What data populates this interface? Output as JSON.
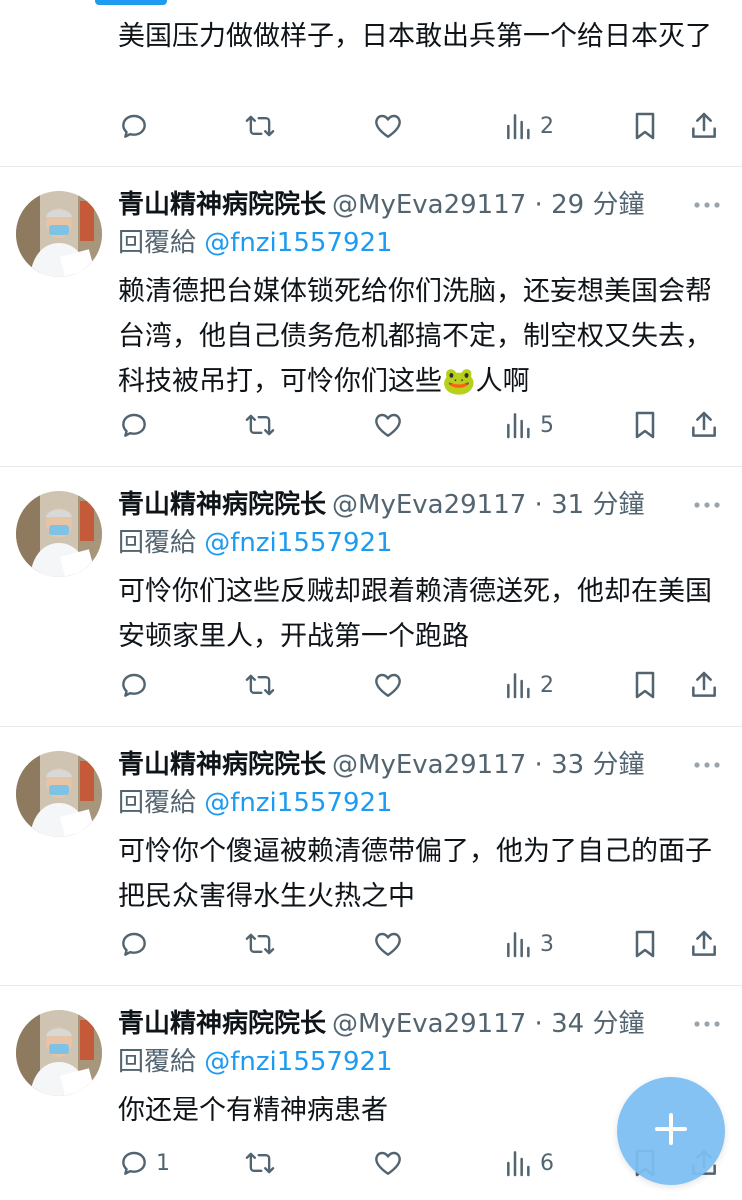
{
  "partial_tweet": {
    "text": "美国压力做做样子，日本敢出兵第一个给日本灭了",
    "views": "2"
  },
  "tweets": [
    {
      "name": "青山精神病院院长",
      "handle": "@MyEva29117",
      "time": "29 分鐘",
      "reply_prefix": "回覆給",
      "reply_to": "@fnzi1557921",
      "text": "赖清德把台媒体锁死给你们洗脑，还妄想美国会帮台湾，他自己债务危机都搞不定，制空权又失去，科技被吊打，可怜你们这些🐸人啊",
      "replies": "",
      "views": "5"
    },
    {
      "name": "青山精神病院院长",
      "handle": "@MyEva29117",
      "time": "31 分鐘",
      "reply_prefix": "回覆給",
      "reply_to": "@fnzi1557921",
      "text": "可怜你们这些反贼却跟着赖清德送死，他却在美国安顿家里人，开战第一个跑路",
      "replies": "",
      "views": "2"
    },
    {
      "name": "青山精神病院院长",
      "handle": "@MyEva29117",
      "time": "33 分鐘",
      "reply_prefix": "回覆給",
      "reply_to": "@fnzi1557921",
      "text": "可怜你个傻逼被赖清德带偏了，他为了自己的面子把民众害得水生火热之中",
      "replies": "",
      "views": "3"
    },
    {
      "name": "青山精神病院院长",
      "handle": "@MyEva29117",
      "time": "34 分鐘",
      "reply_prefix": "回覆給",
      "reply_to": "@fnzi1557921",
      "text": "你还是个有精神病患者",
      "replies": "1",
      "views": "6"
    }
  ],
  "icons": {
    "reply": "reply-icon",
    "retweet": "retweet-icon",
    "like": "heart-icon",
    "views": "views-icon",
    "bookmark": "bookmark-icon",
    "share": "share-icon",
    "more": "more-icon",
    "compose": "plus-icon"
  },
  "colors": {
    "accent": "#1d9bf0",
    "secondary_text": "#536471",
    "divider": "#e7e9ea",
    "fab": "#7dbff2"
  }
}
